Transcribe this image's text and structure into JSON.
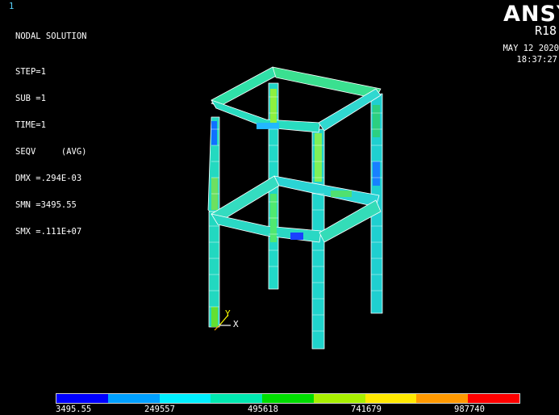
{
  "window_number": "1",
  "solution_title": "NODAL SOLUTION",
  "step": "STEP=1",
  "sub": "SUB =1",
  "time_step": "TIME=1",
  "result_type": "SEQV     (AVG)",
  "dmx": "DMX =.294E-03",
  "smn": "SMN =3495.55",
  "smx": "SMX =.111E+07",
  "brand": "ANSY",
  "version": "R18",
  "date": "MAY 12 2020",
  "clock": "18:37:27",
  "triad": {
    "y": "Y",
    "x": "X"
  },
  "legend": {
    "colors": [
      "#0000ff",
      "#00a0ff",
      "#00f0ff",
      "#00e8b0",
      "#00dd00",
      "#a8f000",
      "#ffe800",
      "#ff9900",
      "#ff0000"
    ],
    "labels": [
      "3495.55",
      "249557",
      "495618",
      "741679",
      "987740"
    ]
  }
}
